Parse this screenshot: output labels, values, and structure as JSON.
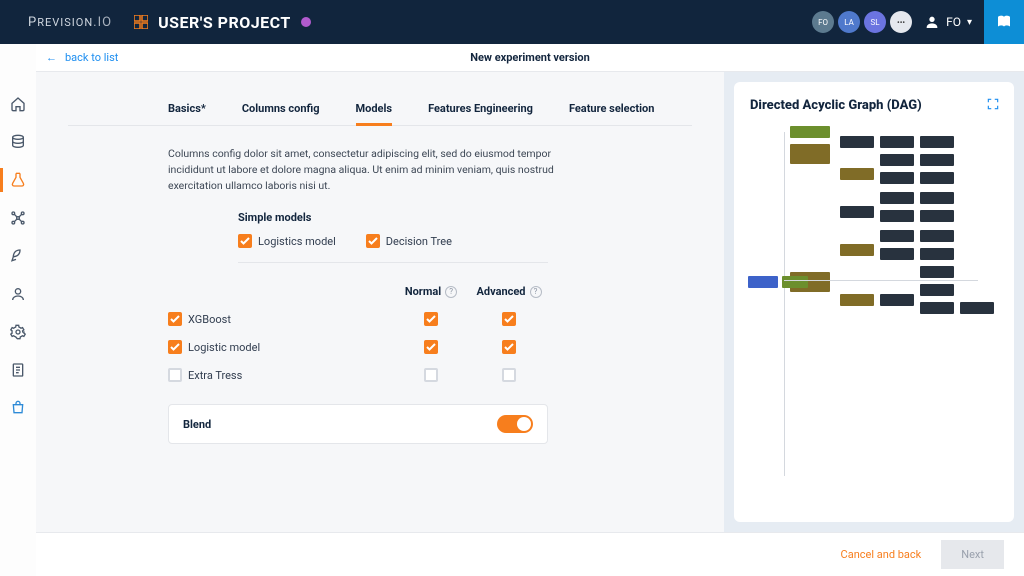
{
  "brand": {
    "name": "Prevision.io"
  },
  "project": {
    "title": "USER'S PROJECT"
  },
  "header": {
    "avatars": [
      "FO",
      "LA",
      "SL"
    ],
    "more": "•••",
    "user": "FO"
  },
  "leftRail": {
    "items": [
      "home",
      "data",
      "experiments",
      "pipelines",
      "deploy",
      "users",
      "settings",
      "docs",
      "store"
    ]
  },
  "crumb": {
    "back": "back to list",
    "title": "New experiment version"
  },
  "tabs": {
    "items": [
      "Basics*",
      "Columns config",
      "Models",
      "Features Engineering",
      "Feature selection"
    ],
    "activeIndex": 2
  },
  "description": "Columns config dolor sit amet, consectetur adipiscing elit, sed do eiusmod tempor incididunt ut labore et dolore magna aliqua. Ut enim ad minim veniam, quis nostrud exercitation ullamco laboris nisi ut.",
  "models": {
    "simple_heading": "Simple models",
    "simple": [
      {
        "label": "Logistics model",
        "checked": true
      },
      {
        "label": "Decision Tree",
        "checked": true
      }
    ],
    "grid_head_normal": "Normal",
    "grid_head_advanced": "Advanced",
    "rows": [
      {
        "label": "XGBoost",
        "row_checked": true,
        "normal": true,
        "advanced": true
      },
      {
        "label": "Logistic model",
        "row_checked": true,
        "normal": true,
        "advanced": true
      },
      {
        "label": "Extra Tress",
        "row_checked": false,
        "normal": false,
        "advanced": false
      }
    ],
    "blend_label": "Blend",
    "blend_on": true
  },
  "dag": {
    "title": "Directed Acyclic Graph (DAG)"
  },
  "footer": {
    "cancel": "Cancel and back",
    "next": "Next"
  },
  "colors": {
    "accent": "#f77e1d",
    "link": "#1d8ef0",
    "navy": "#11253d"
  }
}
